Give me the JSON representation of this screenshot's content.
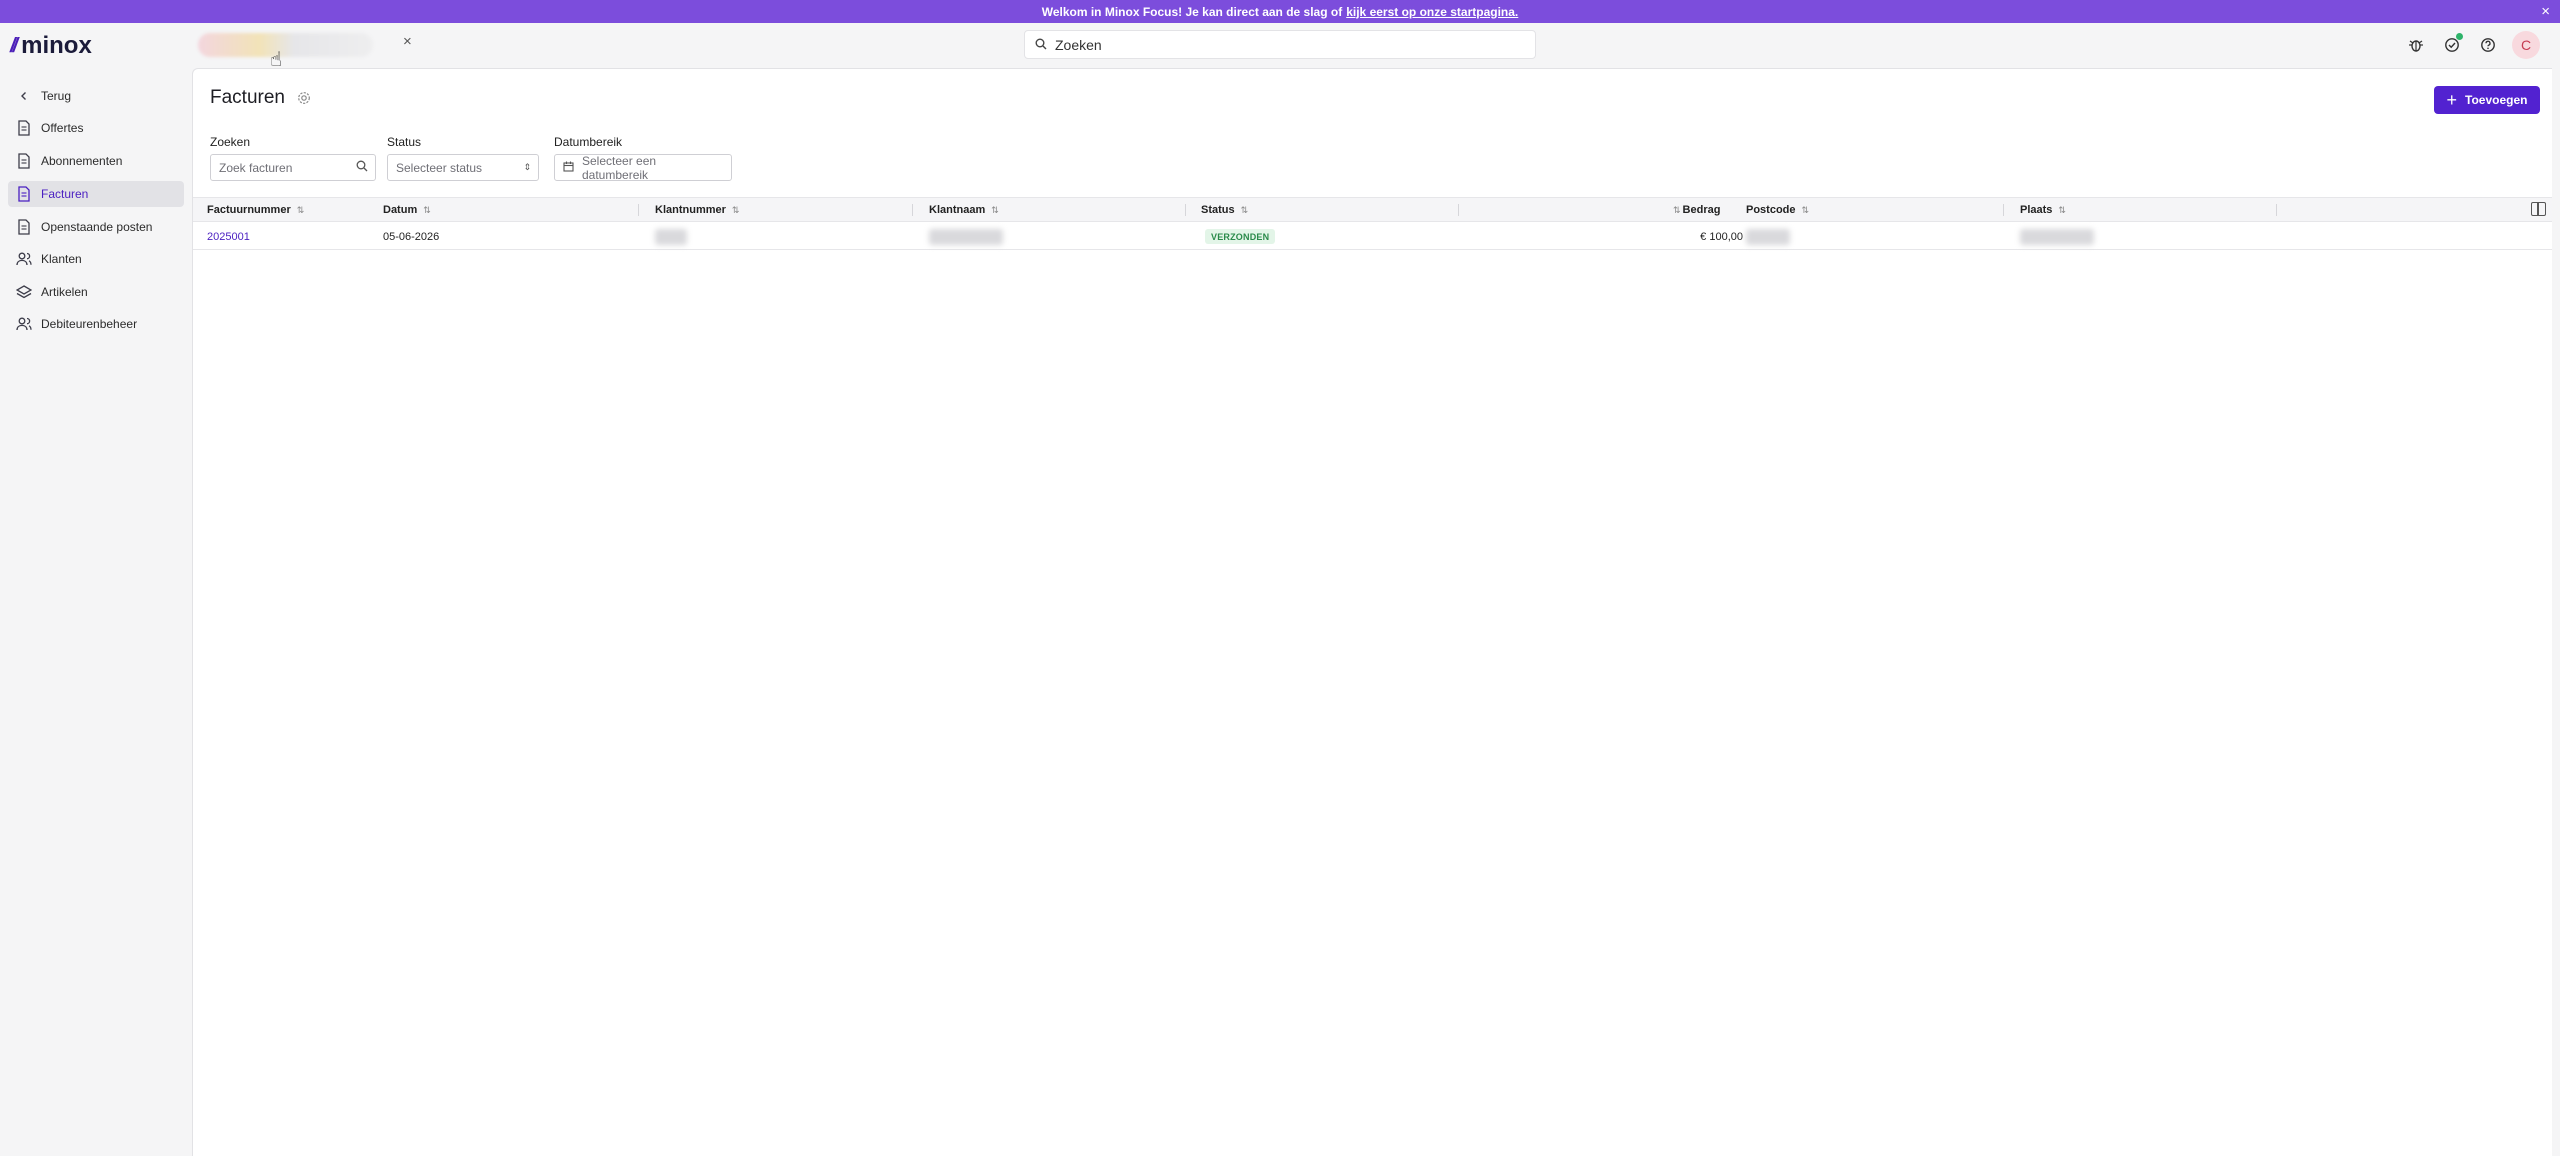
{
  "banner": {
    "text": "Welkom in Minox Focus! Je kan direct aan de slag of",
    "link": "kijk eerst op onze startpagina.",
    "close": "×"
  },
  "topbar": {
    "logo_mark": "//",
    "logo_text": "minox",
    "company_close": "×",
    "search_placeholder": "Zoeken",
    "avatar_initial": "C"
  },
  "sidebar": {
    "items": [
      {
        "label": "Terug",
        "icon": "chevron-left-icon"
      },
      {
        "label": "Offertes",
        "icon": "document-icon"
      },
      {
        "label": "Abonnementen",
        "icon": "document-icon"
      },
      {
        "label": "Facturen",
        "icon": "document-icon",
        "active": true
      },
      {
        "label": "Openstaande posten",
        "icon": "document-icon"
      },
      {
        "label": "Klanten",
        "icon": "users-icon"
      },
      {
        "label": "Artikelen",
        "icon": "layers-icon"
      },
      {
        "label": "Debiteurenbeheer",
        "icon": "users-icon"
      }
    ]
  },
  "page": {
    "title": "Facturen",
    "add_label": "Toevoegen"
  },
  "filters": {
    "search_label": "Zoeken",
    "search_placeholder": "Zoek facturen",
    "status_label": "Status",
    "status_placeholder": "Selecteer status",
    "date_label": "Datumbereik",
    "date_placeholder": "Selecteer een datumbereik"
  },
  "table": {
    "columns": [
      "Factuurnummer",
      "Datum",
      "Klantnummer",
      "Klantnaam",
      "Status",
      "Bedrag",
      "Postcode",
      "Plaats"
    ],
    "rows": [
      {
        "factuurnummer": "2025001",
        "datum": "05-06-2026",
        "status": "VERZONDEN",
        "bedrag": "€ 100,00"
      }
    ]
  },
  "colors": {
    "accent": "#5222d0",
    "banner": "#7c4ddc",
    "status_sent_bg": "#e3f5e8",
    "status_sent_fg": "#2a8a4a"
  }
}
